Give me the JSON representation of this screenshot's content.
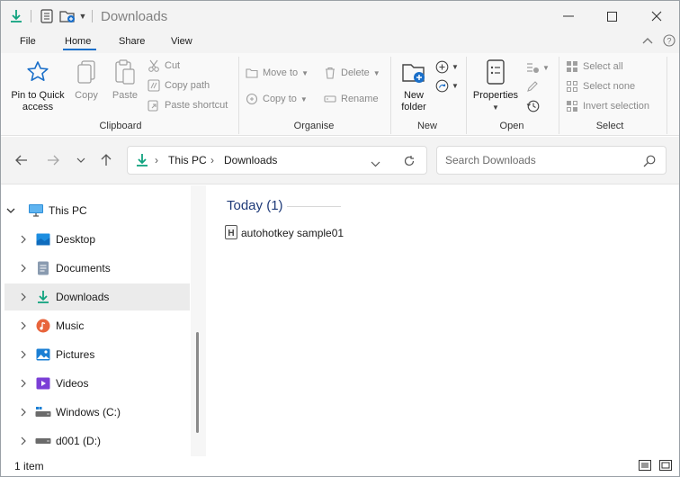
{
  "window": {
    "title": "Downloads"
  },
  "ribbon_tabs": [
    {
      "label": "File"
    },
    {
      "label": "Home"
    },
    {
      "label": "Share"
    },
    {
      "label": "View"
    }
  ],
  "clipboard": {
    "pin_label": "Pin to Quick access",
    "copy_label": "Copy",
    "paste_label": "Paste",
    "cut_label": "Cut",
    "copy_path_label": "Copy path",
    "paste_shortcut_label": "Paste shortcut",
    "group_label": "Clipboard"
  },
  "organise": {
    "move_to_label": "Move to",
    "copy_to_label": "Copy to",
    "delete_label": "Delete",
    "rename_label": "Rename",
    "group_label": "Organise"
  },
  "new": {
    "new_folder_label": "New folder",
    "group_label": "New"
  },
  "open": {
    "properties_label": "Properties",
    "group_label": "Open"
  },
  "select": {
    "select_all_label": "Select all",
    "select_none_label": "Select none",
    "invert_label": "Invert selection",
    "group_label": "Select"
  },
  "address": {
    "crumbs": [
      "This PC",
      "Downloads"
    ]
  },
  "search": {
    "placeholder": "Search Downloads"
  },
  "nav": {
    "root": {
      "label": "This PC"
    },
    "items": [
      {
        "label": "Desktop",
        "icon": "desktop-icon"
      },
      {
        "label": "Documents",
        "icon": "documents-icon"
      },
      {
        "label": "Downloads",
        "icon": "downloads-icon",
        "selected": true
      },
      {
        "label": "Music",
        "icon": "music-icon"
      },
      {
        "label": "Pictures",
        "icon": "pictures-icon"
      },
      {
        "label": "Videos",
        "icon": "videos-icon"
      },
      {
        "label": "Windows (C:)",
        "icon": "drive-icon"
      },
      {
        "label": "d001 (D:)",
        "icon": "drive-icon"
      }
    ]
  },
  "content": {
    "group_header": "Today (1)",
    "files": [
      {
        "name": "autohotkey sample01",
        "icon": "ahk-file-icon"
      }
    ]
  },
  "status": {
    "item_count": "1 item"
  },
  "colors": {
    "accent": "#1a6fc9",
    "download_green": "#10a37f",
    "group_header": "#1e3a78"
  }
}
